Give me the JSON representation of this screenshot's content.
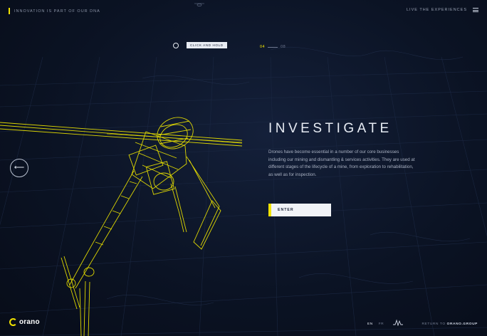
{
  "header": {
    "tagline": "INNOVATION IS PART OF OUR DNA",
    "live_label": "LIVE THE EXPERIENCES",
    "menu_icon": "hamburger-menu-icon",
    "top_mark_icon": "drone-silhouette-icon"
  },
  "hold": {
    "icon": "hold-circle-icon",
    "label": "CLICK AND HOLD"
  },
  "pager": {
    "current": "04",
    "total": "08"
  },
  "main": {
    "title": "INVESTIGATE",
    "description": "Drones have become essential in a number of our core businesses including our mining and dismantling & services activities. They are used at different stages of the lifecycle of a mine, from exploration to rehabilitation, as well as for inspection.",
    "enter_label": "ENTER",
    "visual": "wireframe-helicopter-drone"
  },
  "nav": {
    "prev_icon": "arrow-left-icon"
  },
  "footer": {
    "logo_text": "orano",
    "lang_active": "EN",
    "lang_other": "FR",
    "sound_icon": "sound-wave-icon",
    "return_prefix": "RETURN TO",
    "return_site": "ORANO.GROUP"
  },
  "colors": {
    "accent": "#f2e300",
    "background": "#0a1020",
    "text": "#e6ebf3"
  }
}
